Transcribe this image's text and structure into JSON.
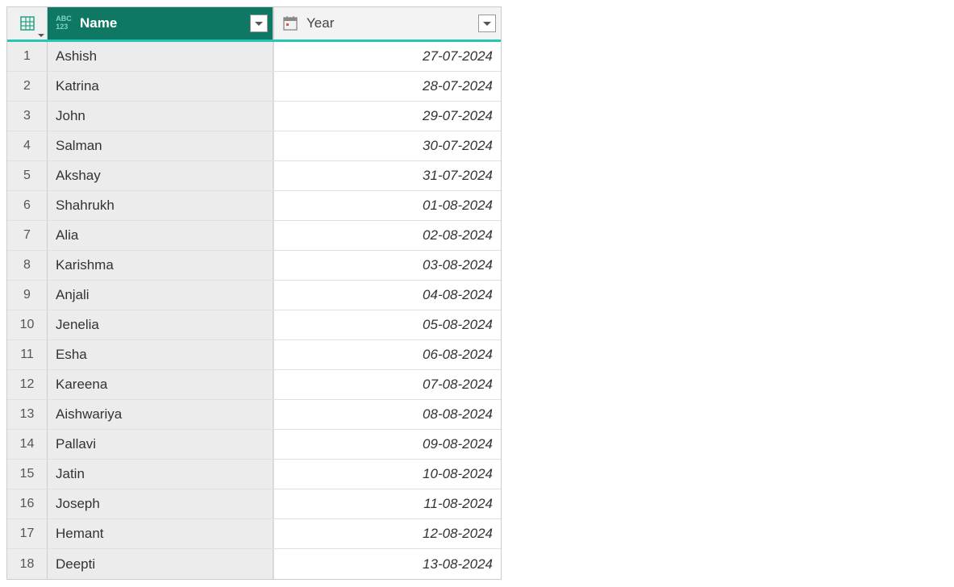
{
  "columns": {
    "name": {
      "label": "Name",
      "type_icon": "abc123"
    },
    "year": {
      "label": "Year",
      "type_icon": "date"
    }
  },
  "rows": [
    {
      "num": "1",
      "name": "Ashish",
      "year": "27-07-2024"
    },
    {
      "num": "2",
      "name": "Katrina",
      "year": "28-07-2024"
    },
    {
      "num": "3",
      "name": "John",
      "year": "29-07-2024"
    },
    {
      "num": "4",
      "name": "Salman",
      "year": "30-07-2024"
    },
    {
      "num": "5",
      "name": "Akshay",
      "year": "31-07-2024"
    },
    {
      "num": "6",
      "name": "Shahrukh",
      "year": "01-08-2024"
    },
    {
      "num": "7",
      "name": "Alia",
      "year": "02-08-2024"
    },
    {
      "num": "8",
      "name": "Karishma",
      "year": "03-08-2024"
    },
    {
      "num": "9",
      "name": "Anjali",
      "year": "04-08-2024"
    },
    {
      "num": "10",
      "name": "Jenelia",
      "year": "05-08-2024"
    },
    {
      "num": "11",
      "name": "Esha",
      "year": "06-08-2024"
    },
    {
      "num": "12",
      "name": "Kareena",
      "year": "07-08-2024"
    },
    {
      "num": "13",
      "name": "Aishwariya",
      "year": "08-08-2024"
    },
    {
      "num": "14",
      "name": "Pallavi",
      "year": "09-08-2024"
    },
    {
      "num": "15",
      "name": "Jatin",
      "year": "10-08-2024"
    },
    {
      "num": "16",
      "name": "Joseph",
      "year": "11-08-2024"
    },
    {
      "num": "17",
      "name": "Hemant",
      "year": "12-08-2024"
    },
    {
      "num": "18",
      "name": "Deepti",
      "year": "13-08-2024"
    }
  ]
}
